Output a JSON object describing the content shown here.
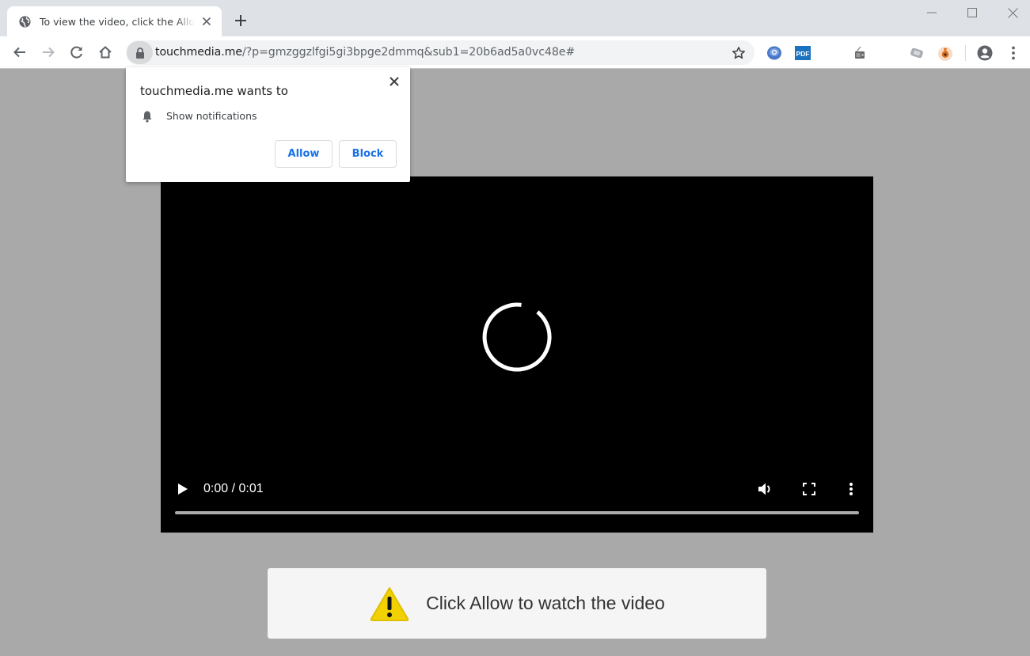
{
  "browser": {
    "tab": {
      "title": "To view the video, click the Allow button",
      "favicon": "globe-icon"
    },
    "window_controls": [
      "minimize",
      "maximize",
      "close"
    ],
    "toolbar": {
      "url_host": "touchmedia.me",
      "url_rest": "/?p=gmzggzlfgi5gi3bpge2dmmq&sub1=20b6ad5a0vc48e#",
      "extensions": [
        "disc-extension-icon",
        "pdf-extension-icon",
        "radio-extension-icon",
        "ticket-extension-icon",
        "money-bag-extension-icon"
      ],
      "pdf_label": "PDF"
    }
  },
  "permission_popup": {
    "title": "touchmedia.me wants to",
    "permission": "Show notifications",
    "allow_label": "Allow",
    "block_label": "Block"
  },
  "video": {
    "time": "0:00 / 0:01",
    "progress": 0,
    "loading": true
  },
  "notice": {
    "text": "Click Allow to watch the video",
    "icon": "warning-icon",
    "accent": "#f2d100"
  }
}
